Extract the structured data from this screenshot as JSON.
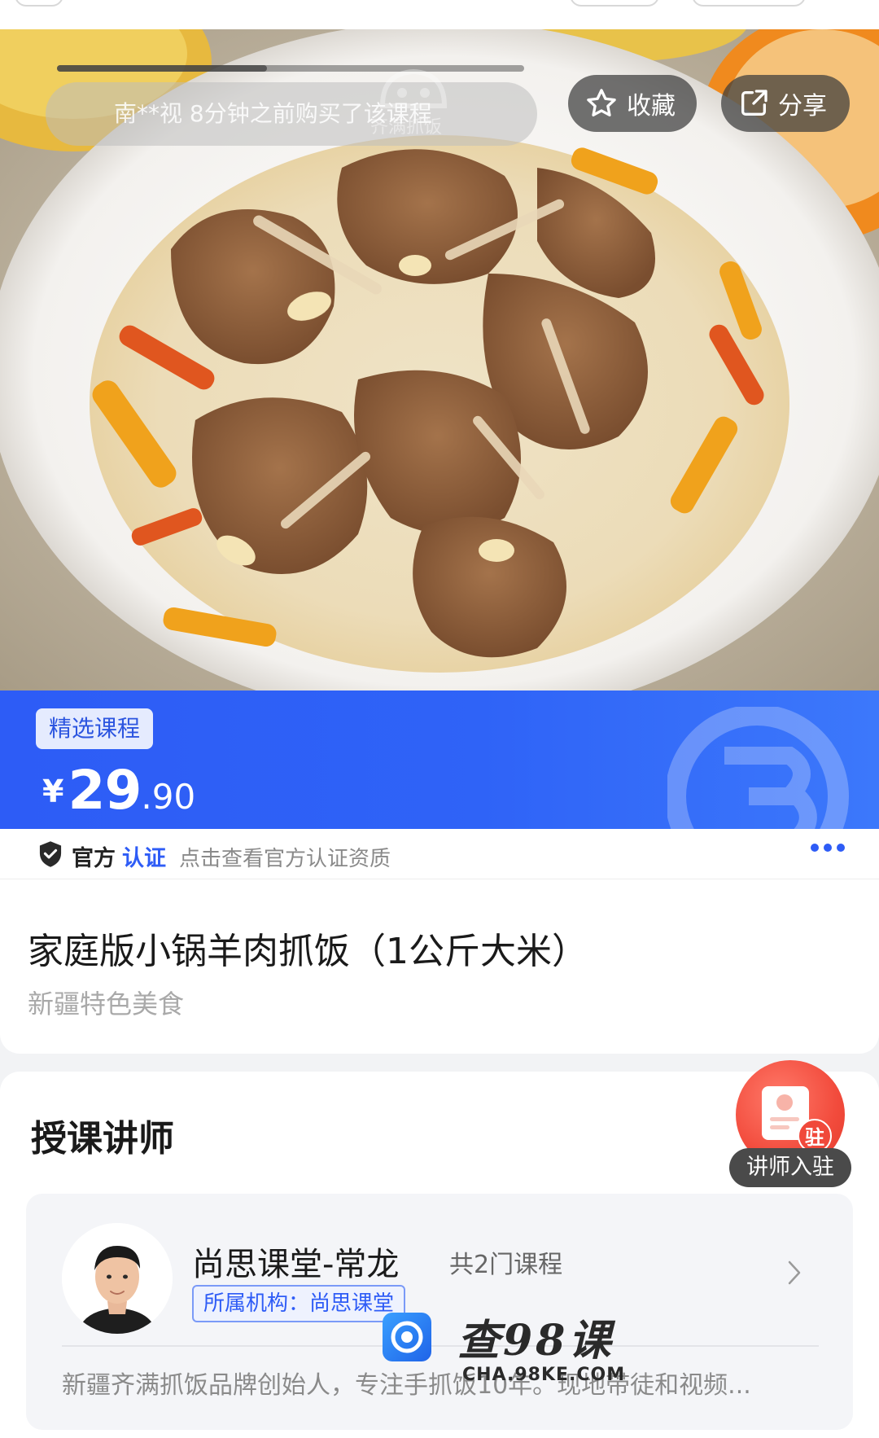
{
  "hero": {
    "purchase_notice": "南**视 8分钟之前购买了该课程",
    "watermark_text": "齐满抓饭",
    "favorite_label": "收藏",
    "share_label": "分享",
    "progress": 0.45
  },
  "price_banner": {
    "tag": "精选课程",
    "currency": "¥",
    "price_integer": "29",
    "price_decimal": ".90"
  },
  "certification": {
    "label_official": "官方",
    "label_cert": "认证",
    "description": "点击查看官方认证资质"
  },
  "course": {
    "title": "家庭版小锅羊肉抓饭（1公斤大米）",
    "subtitle": "新疆特色美食"
  },
  "teacher_section": {
    "heading": "授课讲师",
    "join_label": "讲师入驻",
    "join_badge": "驻",
    "teacher": {
      "name": "尚思课堂-常龙",
      "course_count": "共2门课程",
      "organization": "所属机构：尚思课堂",
      "bio": "新疆齐满抓饭品牌创始人，专注手抓饭10年。现地带徒和视频..."
    }
  },
  "watermark": {
    "main": "查98课",
    "url": "CHA.98KE.COM"
  },
  "colors": {
    "brand_blue": "#2e5cf6",
    "join_red": "#f0493b"
  }
}
